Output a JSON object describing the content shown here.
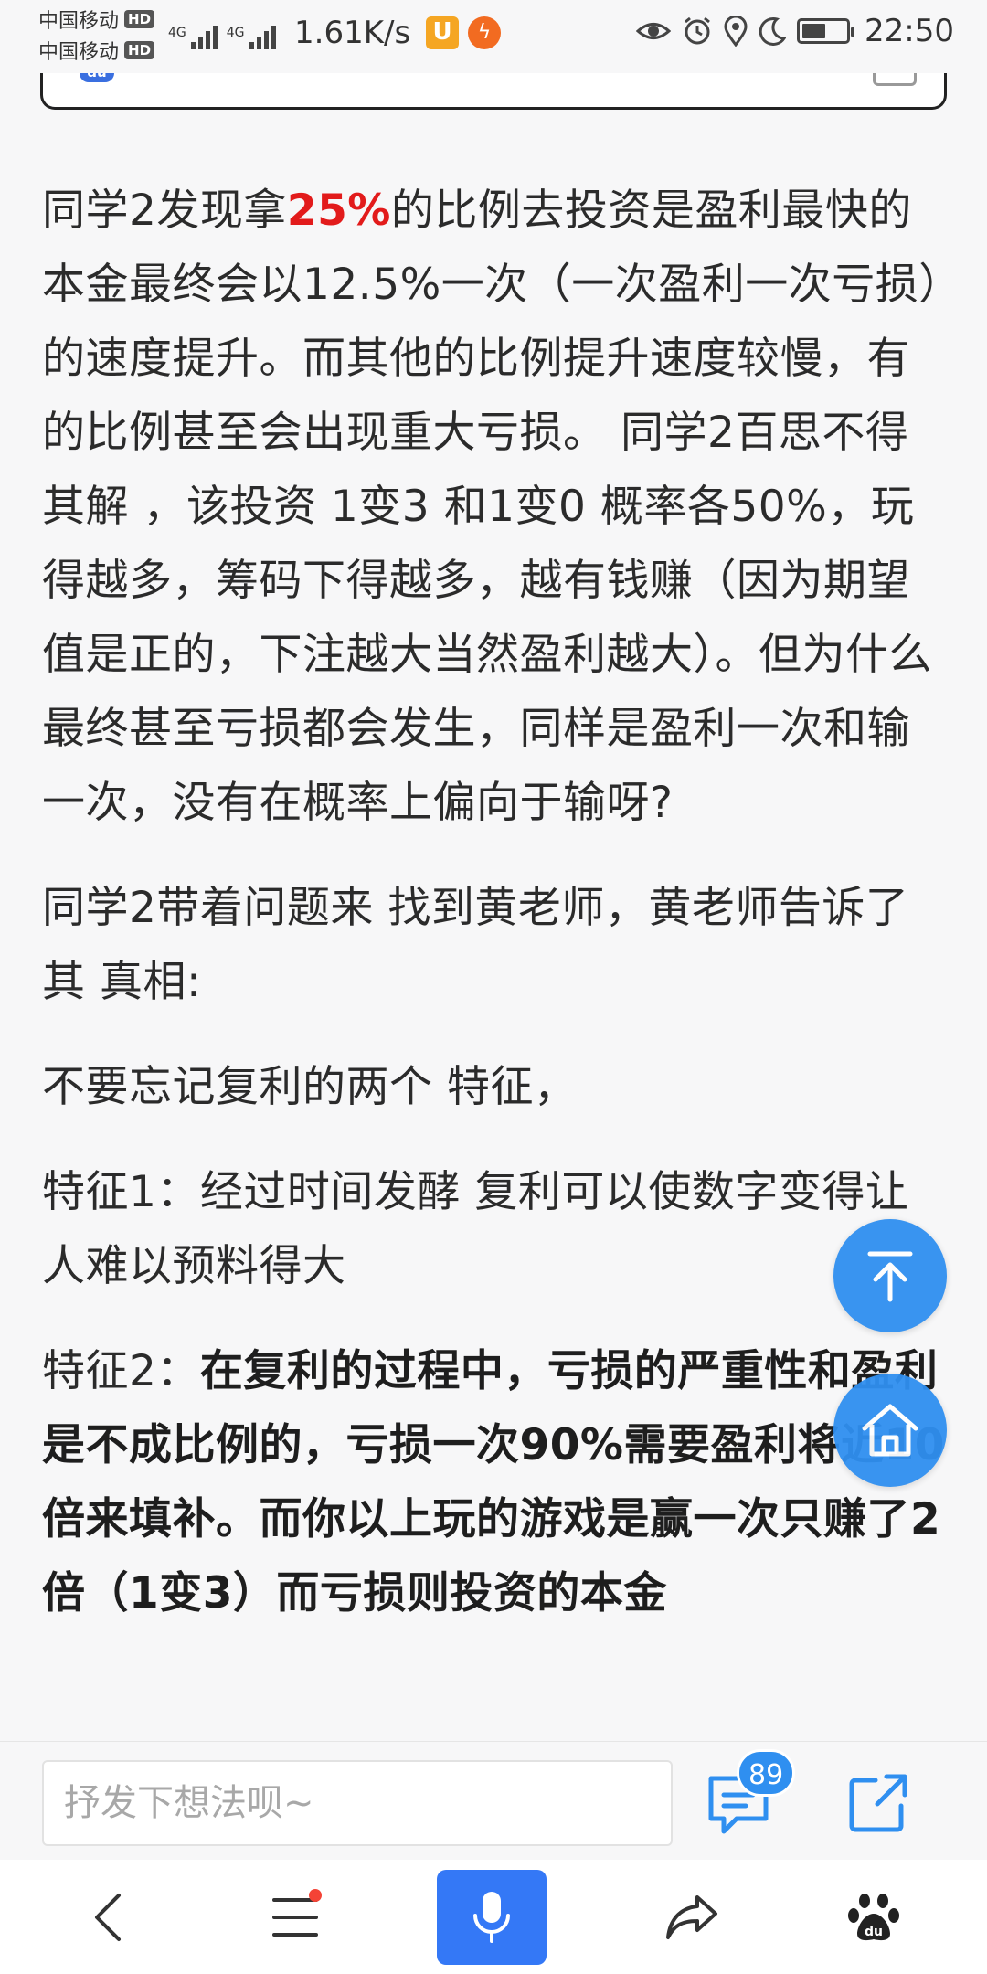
{
  "status_bar": {
    "carrier_1": "中国移动",
    "carrier_2": "中国移动",
    "hd_label": "HD",
    "network_tag": "4G",
    "net_speed": "1.61K/s",
    "time": "22:50",
    "battery_level_percent": 55,
    "icons": [
      "eye-icon",
      "alarm-icon",
      "location-icon",
      "moon-icon",
      "battery-icon"
    ]
  },
  "top_card": {
    "badge_label": "du"
  },
  "article": {
    "p1_pre": "同学2发现拿",
    "p1_highlight": "25%",
    "p1_post": "的比例去投资是盈利最快的本金最终会以12.5%一次（一次盈利一次亏损）的速度提升。而其他的比例提升速度较慢，有的比例甚至会出现重大亏损。 同学2百思不得其解 ，该投资 1变3 和1变0 概率各50%，玩得越多，筹码下得越多，越有钱赚（因为期望值是正的，下注越大当然盈利越大）。但为什么最终甚至亏损都会发生，同样是盈利一次和输一次，没有在概率上偏向于输呀?",
    "p2": "同学2带着问题来 找到黄老师，黄老师告诉了其 真相:",
    "p3": "不要忘记复利的两个 特征，",
    "p4": "特征1：经过时间发酵 复利可以使数字变得让人难以预料得大",
    "p5_label": "特征2：",
    "p5_bold": "在复利的过程中，亏损的严重性和盈利是不成比例的，亏损一次90%需要盈利将近10倍来填补。而你以上玩的游戏是赢一次只赚了2倍（1变3）而亏损则投资的本金"
  },
  "comment_bar": {
    "placeholder": "抒发下想法呗~",
    "comment_count": "89"
  },
  "accent_color": "#2f8ff0"
}
